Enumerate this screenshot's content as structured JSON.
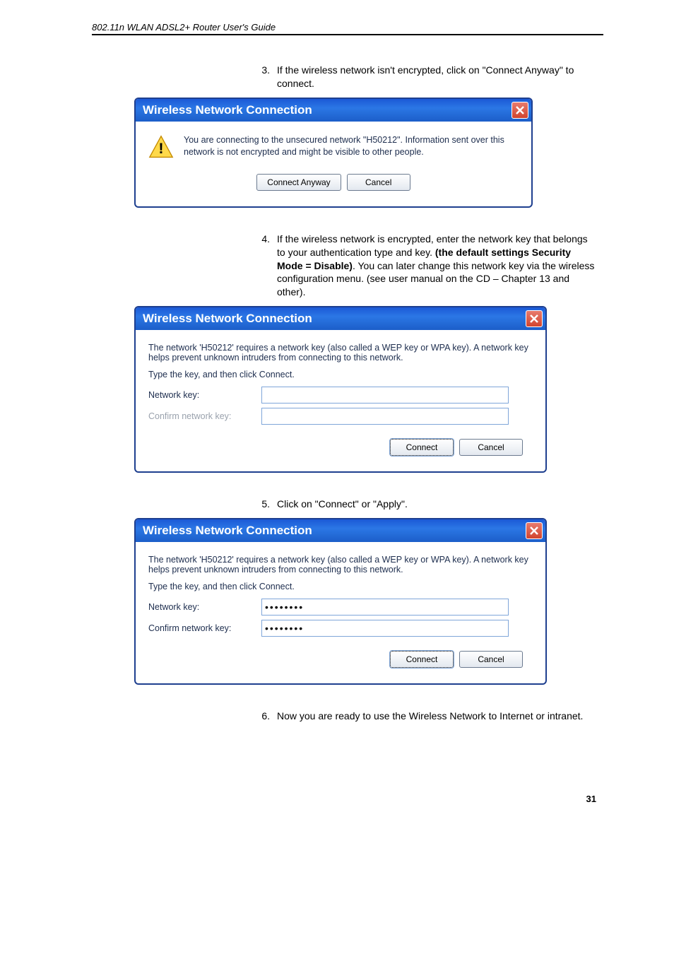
{
  "header": "802.11n WLAN ADSL2+ Router User's Guide",
  "step3": {
    "num": "3.",
    "text": "If the wireless network isn't encrypted, click on \"Connect Anyway\" to connect."
  },
  "dialog1": {
    "title": "Wireless Network Connection",
    "body": "You are connecting to the unsecured network \"H50212\". Information sent over this network is not encrypted and might be visible to other people.",
    "btn_connect": "Connect Anyway",
    "btn_cancel": "Cancel"
  },
  "step4": {
    "num": "4.",
    "text_a": "If the wireless network is encrypted, enter the network key that belongs to your authentication type and key. ",
    "text_bold": "(the default settings Security Mode = Disable)",
    "text_b": ". You can later change this network key via the wireless configuration menu. (see user manual on the CD – Chapter 13 and other)."
  },
  "dialog2": {
    "title": "Wireless Network Connection",
    "instr1": "The network 'H50212' requires a network key (also called a WEP key or WPA key). A network key helps prevent unknown intruders from connecting to this network.",
    "instr2": "Type the key, and then click Connect.",
    "label_key": "Network key:",
    "label_confirm": "Confirm network key:",
    "val_key": "",
    "val_confirm": "",
    "btn_connect": "Connect",
    "btn_cancel": "Cancel"
  },
  "step5": {
    "num": "5.",
    "text": "Click on \"Connect\" or \"Apply\"."
  },
  "dialog3": {
    "title": "Wireless Network Connection",
    "instr1": "The network 'H50212' requires a network key (also called a WEP key or WPA key). A network key helps prevent unknown intruders from connecting to this network.",
    "instr2": "Type the key, and then click Connect.",
    "label_key": "Network key:",
    "label_confirm": "Confirm network key:",
    "val_key": "••••••••",
    "val_confirm": "••••••••",
    "btn_connect": "Connect",
    "btn_cancel": "Cancel"
  },
  "step6": {
    "num": "6.",
    "text": "Now you are ready to use the Wireless Network to Internet or intranet."
  },
  "page_number": "31"
}
